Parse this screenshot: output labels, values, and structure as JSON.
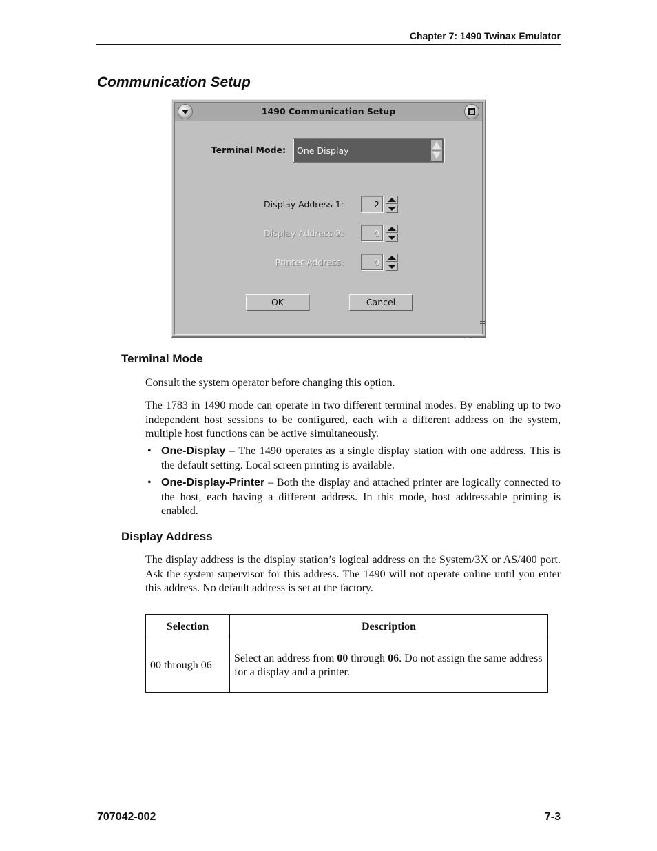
{
  "header": {
    "running_head": "Chapter 7: 1490 Twinax Emulator"
  },
  "section_title": "Communication Setup",
  "dialog": {
    "title": "1490 Communication Setup",
    "window_menu_icon": "window-menu-icon",
    "maximize_icon": "maximize-icon",
    "terminal_mode": {
      "label": "Terminal Mode:",
      "value": "One Display"
    },
    "fields": [
      {
        "label": "Display Address 1:",
        "value": "2",
        "enabled": true
      },
      {
        "label": "Display Address 2:",
        "value": "0",
        "enabled": false
      },
      {
        "label": "Printer Address:",
        "value": "0",
        "enabled": false
      }
    ],
    "buttons": {
      "ok": "OK",
      "cancel": "Cancel"
    }
  },
  "terminal_mode_section": {
    "heading": "Terminal Mode",
    "para1": "Consult the system operator before changing this option.",
    "para2": "The 1783 in 1490 mode can operate in two different terminal modes. By enabling up to two independent host sessions to be configured, each with a different address on the system, multiple host functions can be active simultaneously.",
    "bullets": [
      {
        "term": "One-Display",
        "text": " – The 1490 operates as a single display station with one address. This is the default setting. Local screen printing is available."
      },
      {
        "term": "One-Display-Printer",
        "text": " – Both the display and attached printer are logically connected to the host, each having a different address. In this mode, host addressable printing is enabled."
      }
    ]
  },
  "display_address_section": {
    "heading": "Display Address",
    "para": "The display address is the display station’s logical address on the System/3X or AS/400 port. Ask the system supervisor for this address. The 1490 will not operate online until you enter this address. No default address is set at the factory.",
    "table": {
      "headers": [
        "Selection",
        "Description"
      ],
      "rows": [
        {
          "selection": "00 through 06",
          "desc_pre": "Select an address from ",
          "desc_b1": "00",
          "desc_mid": " through ",
          "desc_b2": "06",
          "desc_post": ".  Do not assign the same address for a display and a printer."
        }
      ]
    }
  },
  "footer": {
    "doc_number": "707042-002",
    "page_number": "7-3"
  }
}
